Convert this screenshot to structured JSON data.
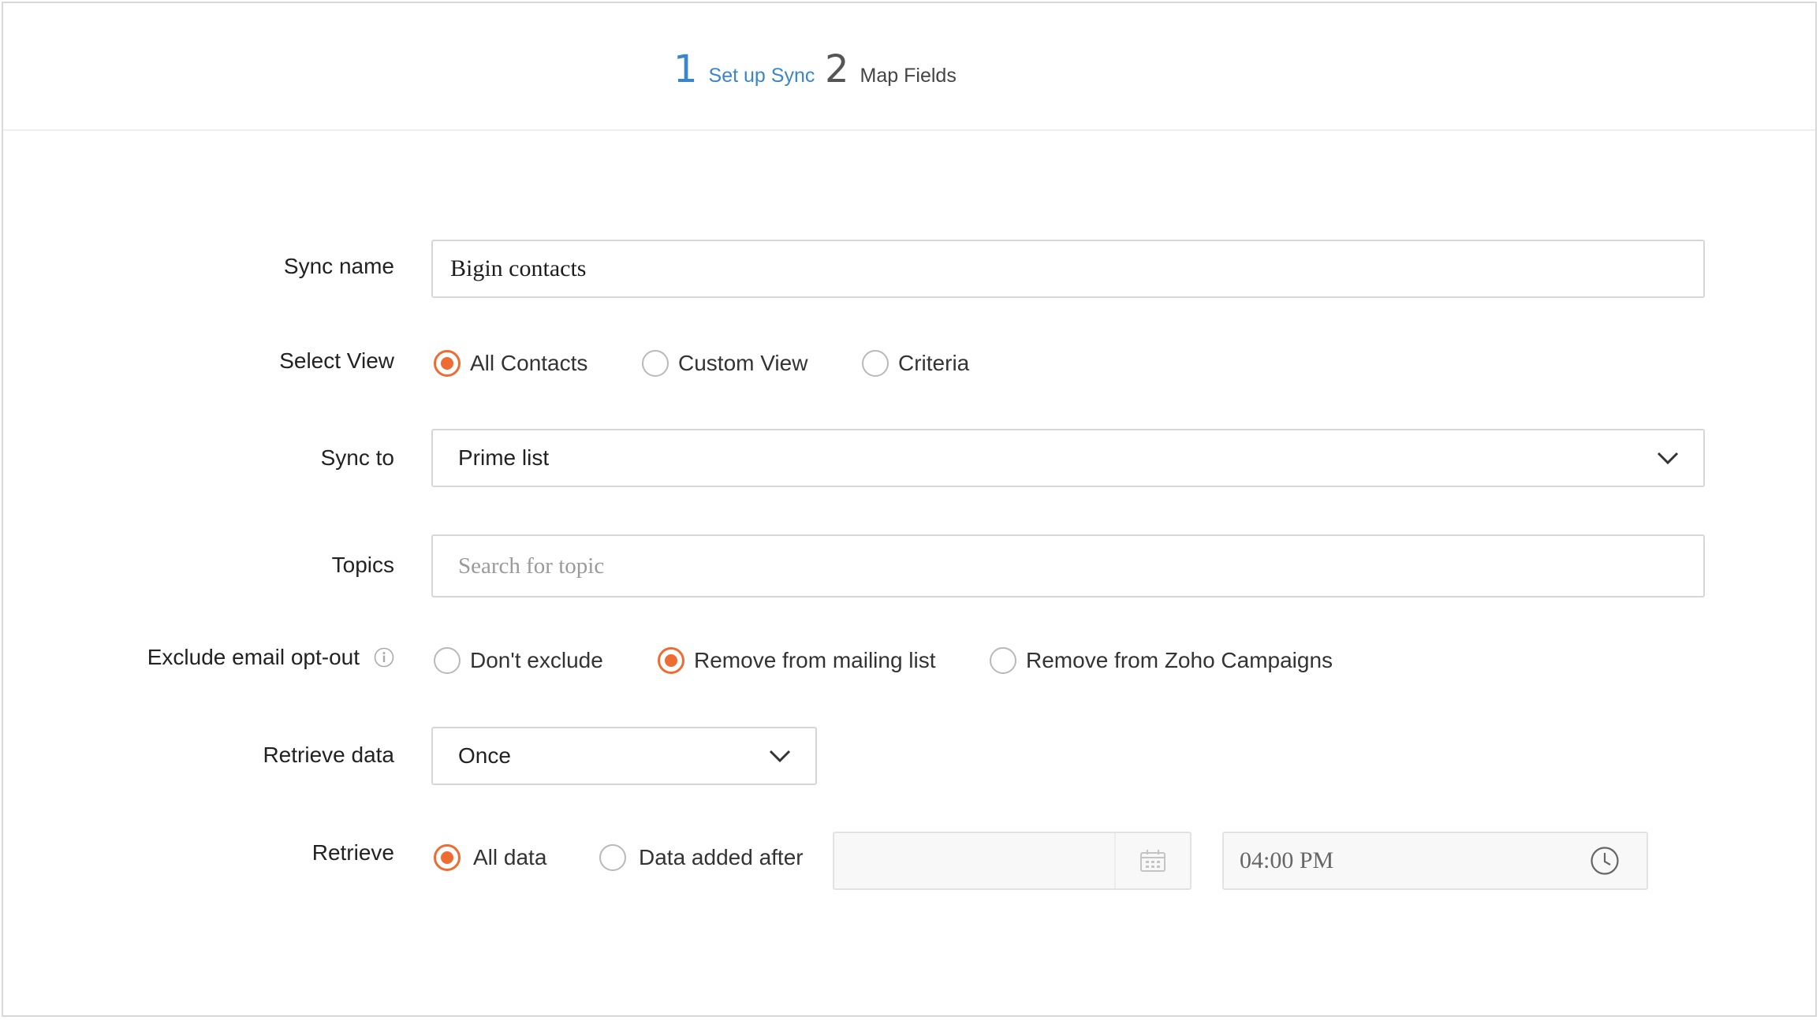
{
  "steps": [
    {
      "num": "1",
      "label": "Set up Sync"
    },
    {
      "num": "2",
      "label": "Map Fields"
    }
  ],
  "form": {
    "sync_name": {
      "label": "Sync name",
      "value": "Bigin contacts"
    },
    "select_view": {
      "label": "Select View",
      "options": [
        "All Contacts",
        "Custom View",
        "Criteria"
      ],
      "selected": "All Contacts"
    },
    "sync_to": {
      "label": "Sync to",
      "value": "Prime list"
    },
    "topics": {
      "label": "Topics",
      "placeholder": "Search for topic"
    },
    "exclude": {
      "label": "Exclude email opt-out",
      "options": [
        "Don't exclude",
        "Remove from mailing list",
        "Remove from Zoho Campaigns"
      ],
      "selected": "Remove from mailing list"
    },
    "retrieve_data": {
      "label": "Retrieve data",
      "value": "Once"
    },
    "retrieve": {
      "label": "Retrieve",
      "options": [
        "All data",
        "Data added after"
      ],
      "selected": "All data",
      "date_value": "",
      "time_value": "04:00 PM"
    }
  },
  "colors": {
    "accent": "#ee6c32",
    "step_active": "#3a86c8"
  },
  "icons": {
    "info": "info-icon",
    "chevron": "chevron-down-icon",
    "calendar": "calendar-icon",
    "clock": "clock-icon"
  }
}
